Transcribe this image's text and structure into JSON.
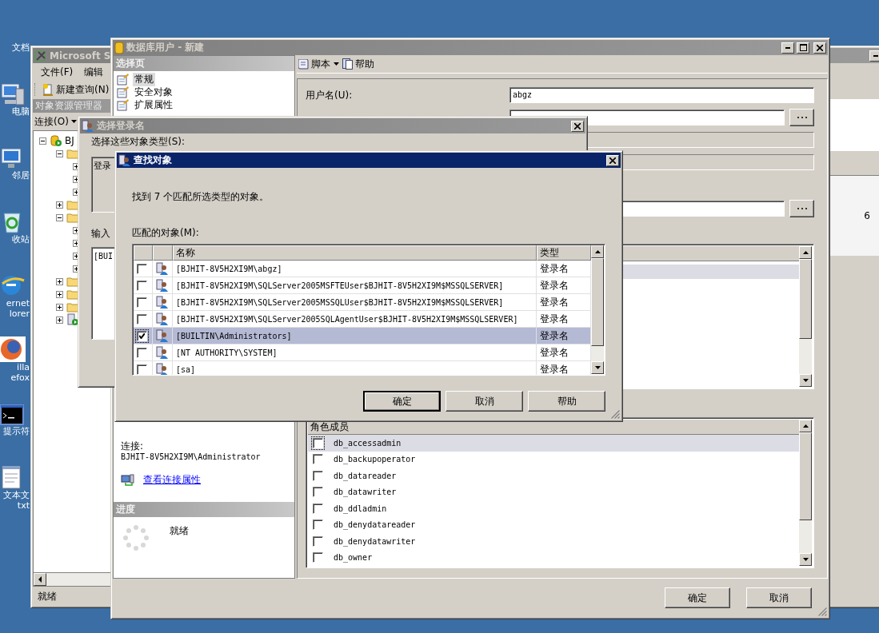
{
  "desktop_icons": [
    {
      "kind": "documents",
      "label": [
        "文档"
      ]
    },
    {
      "kind": "computer",
      "label": [
        "电脑"
      ]
    },
    {
      "kind": "network",
      "label": [
        "邻居"
      ]
    },
    {
      "kind": "recycle",
      "label": [
        "收站"
      ]
    },
    {
      "kind": "browser",
      "label": [
        "ernet",
        "lorer"
      ]
    },
    {
      "kind": "firefox",
      "label": [
        "illa",
        "efox"
      ]
    },
    {
      "kind": "console",
      "label": [
        "提示符"
      ]
    },
    {
      "kind": "notepad",
      "label": [
        "文本文",
        "txt"
      ]
    }
  ],
  "explorer_window": {
    "title": "Microsoft S",
    "menu": [
      "文件(F)",
      "编辑"
    ],
    "toolbar_button": "新建查询(N)",
    "panel_title": "对象资源管理器",
    "connect_button": "连接(O)",
    "tree": [
      {
        "kind": "server",
        "label": "BJ",
        "expanded": true,
        "children": [
          {
            "kind": "folder",
            "expanded": true,
            "children": [
              {
                "expanded": false
              },
              {
                "expanded": false
              },
              {
                "expanded": false
              }
            ]
          },
          {
            "kind": "folder",
            "expanded": false
          },
          {
            "kind": "folder",
            "expanded": true,
            "children": [
              {
                "expanded": false
              },
              {
                "expanded": false
              },
              {
                "expanded": false
              },
              {
                "expanded": false
              }
            ]
          },
          {
            "kind": "folder",
            "expanded": false
          },
          {
            "kind": "folder",
            "expanded": false
          },
          {
            "kind": "folder",
            "expanded": false
          },
          {
            "kind": "agent",
            "expanded": false
          }
        ]
      }
    ],
    "status": "就绪",
    "side_value": "6"
  },
  "db_user_window": {
    "title": "数据库用户 - 新建",
    "pages_header": "选择页",
    "pages": [
      {
        "label": "常规",
        "selected": true
      },
      {
        "label": "安全对象",
        "selected": false
      },
      {
        "label": "扩展属性",
        "selected": false
      }
    ],
    "script_button": "脚本",
    "help_button": "帮助",
    "username_label": "用户名(U):",
    "username": "abgz",
    "connection_label": "连接:",
    "connection_value": "BJHIT-8V5H2XI9M\\Administrator",
    "connection_link": "查看连接属性",
    "progress_header": "进度",
    "progress_status": "就绪",
    "role_members": {
      "header": "角色成员",
      "items": [
        {
          "label": "db_accessadmin",
          "checked": false,
          "selected": true
        },
        {
          "label": "db_backupoperator",
          "checked": false,
          "selected": false
        },
        {
          "label": "db_datareader",
          "checked": false,
          "selected": false
        },
        {
          "label": "db_datawriter",
          "checked": false,
          "selected": false
        },
        {
          "label": "db_ddladmin",
          "checked": false,
          "selected": false
        },
        {
          "label": "db_denydatareader",
          "checked": false,
          "selected": false
        },
        {
          "label": "db_denydatawriter",
          "checked": false,
          "selected": false
        },
        {
          "label": "db_owner",
          "checked": false,
          "selected": false
        }
      ]
    },
    "buttons": [
      "确定",
      "取消"
    ]
  },
  "select_login_window": {
    "title": "选择登录名",
    "object_types_label": "选择这些对象类型(S):",
    "object_types_value": "登录",
    "names_label": "输入",
    "names_value": "[BUI"
  },
  "find_dialog": {
    "title": "查找对象",
    "summary": "找到 7 个匹配所选类型的对象。",
    "list_label": "匹配的对象(M):",
    "columns": [
      "名称",
      "类型"
    ],
    "rows": [
      {
        "name": "[BJHIT-8V5H2XI9M\\abgz]",
        "type": "登录名",
        "checked": false,
        "selected": false
      },
      {
        "name": "[BJHIT-8V5H2XI9M\\SQLServer2005MSFTEUser$BJHIT-8V5H2XI9M$MSSQLSERVER]",
        "type": "登录名",
        "checked": false,
        "selected": false
      },
      {
        "name": "[BJHIT-8V5H2XI9M\\SQLServer2005MSSQLUser$BJHIT-8V5H2XI9M$MSSQLSERVER]",
        "type": "登录名",
        "checked": false,
        "selected": false
      },
      {
        "name": "[BJHIT-8V5H2XI9M\\SQLServer2005SQLAgentUser$BJHIT-8V5H2XI9M$MSSQLSERVER]",
        "type": "登录名",
        "checked": false,
        "selected": false
      },
      {
        "name": "[BUILTIN\\Administrators]",
        "type": "登录名",
        "checked": true,
        "selected": true
      },
      {
        "name": "[NT AUTHORITY\\SYSTEM]",
        "type": "登录名",
        "checked": false,
        "selected": false
      },
      {
        "name": "[sa]",
        "type": "登录名",
        "checked": false,
        "selected": false
      }
    ],
    "buttons": [
      "确定",
      "取消",
      "帮助"
    ]
  }
}
